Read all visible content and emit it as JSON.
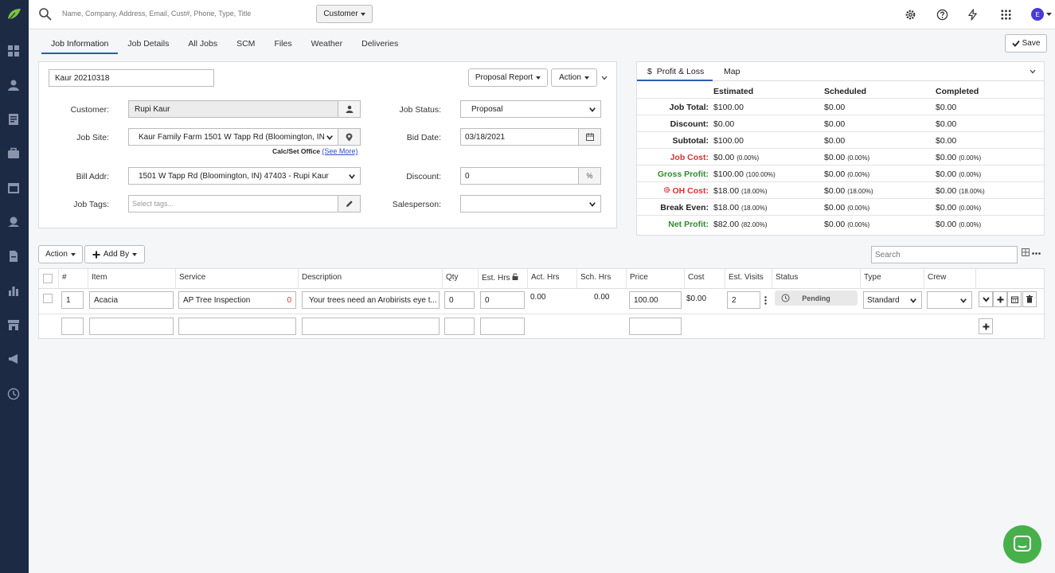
{
  "topbar": {
    "search_placeholder": "Name, Company, Address, Email, Cust#, Phone, Type, Title",
    "customer_button": "Customer",
    "avatar_letter": "E"
  },
  "tabs": [
    {
      "label": "Job Information"
    },
    {
      "label": "Job Details"
    },
    {
      "label": "All Jobs"
    },
    {
      "label": "SCM"
    },
    {
      "label": "Files"
    },
    {
      "label": "Weather"
    },
    {
      "label": "Deliveries"
    }
  ],
  "save_label": "Save",
  "job": {
    "name": "Kaur 20210318",
    "proposal_report": "Proposal Report",
    "action": "Action",
    "customer_label": "Customer:",
    "customer_value": "Rupi Kaur",
    "job_site_label": "Job Site:",
    "job_site_value": "Kaur Family Farm 1501 W Tapp Rd (Bloomington, IN",
    "calc_set_office": "Calc/Set Office",
    "see_more": "(See More)",
    "bill_addr_label": "Bill Addr:",
    "bill_addr_value": "1501 W Tapp Rd (Bloomington, IN) 47403 - Rupi Kaur",
    "job_tags_label": "Job Tags:",
    "job_tags_placeholder": "Select tags...",
    "job_status_label": "Job Status:",
    "job_status_value": "Proposal",
    "bid_date_label": "Bid Date:",
    "bid_date_value": "03/18/2021",
    "discount_label": "Discount:",
    "discount_value": "0",
    "discount_unit": "%",
    "salesperson_label": "Salesperson:",
    "salesperson_value": ""
  },
  "pl": {
    "tab_pl": "Profit & Loss",
    "tab_pl_symbol": "$",
    "tab_map": "Map",
    "headers": [
      "Estimated",
      "Scheduled",
      "Completed"
    ],
    "rows": [
      {
        "label": "Job Total:",
        "color": "#222222",
        "values": [
          {
            "v": "$100.00",
            "p": ""
          },
          {
            "v": "$0.00",
            "p": ""
          },
          {
            "v": "$0.00",
            "p": ""
          }
        ]
      },
      {
        "label": "Discount:",
        "color": "#222222",
        "values": [
          {
            "v": "$0.00",
            "p": ""
          },
          {
            "v": "$0.00",
            "p": ""
          },
          {
            "v": "$0.00",
            "p": ""
          }
        ]
      },
      {
        "label": "Subtotal:",
        "color": "#222222",
        "values": [
          {
            "v": "$100.00",
            "p": ""
          },
          {
            "v": "$0.00",
            "p": ""
          },
          {
            "v": "$0.00",
            "p": ""
          }
        ]
      },
      {
        "label": "Job Cost:",
        "color": "#d93030",
        "values": [
          {
            "v": "$0.00",
            "p": "(0.00%)"
          },
          {
            "v": "$0.00",
            "p": "(0.00%)"
          },
          {
            "v": "$0.00",
            "p": "(0.00%)"
          }
        ]
      },
      {
        "label": "Gross Profit:",
        "color": "#2e8b2e",
        "values": [
          {
            "v": "$100.00",
            "p": "(100.00%)"
          },
          {
            "v": "$0.00",
            "p": "(0.00%)"
          },
          {
            "v": "$0.00",
            "p": "(0.00%)"
          }
        ]
      },
      {
        "label": "OH Cost:",
        "color": "#d93030",
        "values": [
          {
            "v": "$18.00",
            "p": "(18.00%)"
          },
          {
            "v": "$0.00",
            "p": "(18.00%)"
          },
          {
            "v": "$0.00",
            "p": "(18.00%)"
          }
        ]
      },
      {
        "label": "Break Even:",
        "color": "#222222",
        "values": [
          {
            "v": "$18.00",
            "p": "(18.00%)"
          },
          {
            "v": "$0.00",
            "p": "(0.00%)"
          },
          {
            "v": "$0.00",
            "p": "(0.00%)"
          }
        ]
      },
      {
        "label": "Net Profit:",
        "color": "#2e8b2e",
        "values": [
          {
            "v": "$82.00",
            "p": "(82.00%)"
          },
          {
            "v": "$0.00",
            "p": "(0.00%)"
          },
          {
            "v": "$0.00",
            "p": "(0.00%)"
          }
        ]
      }
    ]
  },
  "grid_toolbar": {
    "action": "Action",
    "add_by": "Add By",
    "search_placeholder": "Search"
  },
  "grid": {
    "headers": {
      "num": "#",
      "item": "Item",
      "service": "Service",
      "description": "Description",
      "qty": "Qty",
      "est_hrs": "Est. Hrs",
      "act_hrs": "Act. Hrs",
      "sch_hrs": "Sch. Hrs",
      "price": "Price",
      "cost": "Cost",
      "est_visits": "Est. Visits",
      "status": "Status",
      "type": "Type",
      "crew": "Crew"
    },
    "row": {
      "num": "1",
      "item": "Acacia",
      "service": "AP Tree Inspection",
      "service_badge": "0",
      "description": "Your trees need an Arobirists eye t...",
      "qty": "0",
      "est_hrs": "0",
      "act_hrs": "0.00",
      "sch_hrs": "0.00",
      "price": "100.00",
      "cost": "$0.00",
      "est_visits": "2",
      "status": "Pending",
      "type": "Standard",
      "crew": ""
    }
  }
}
